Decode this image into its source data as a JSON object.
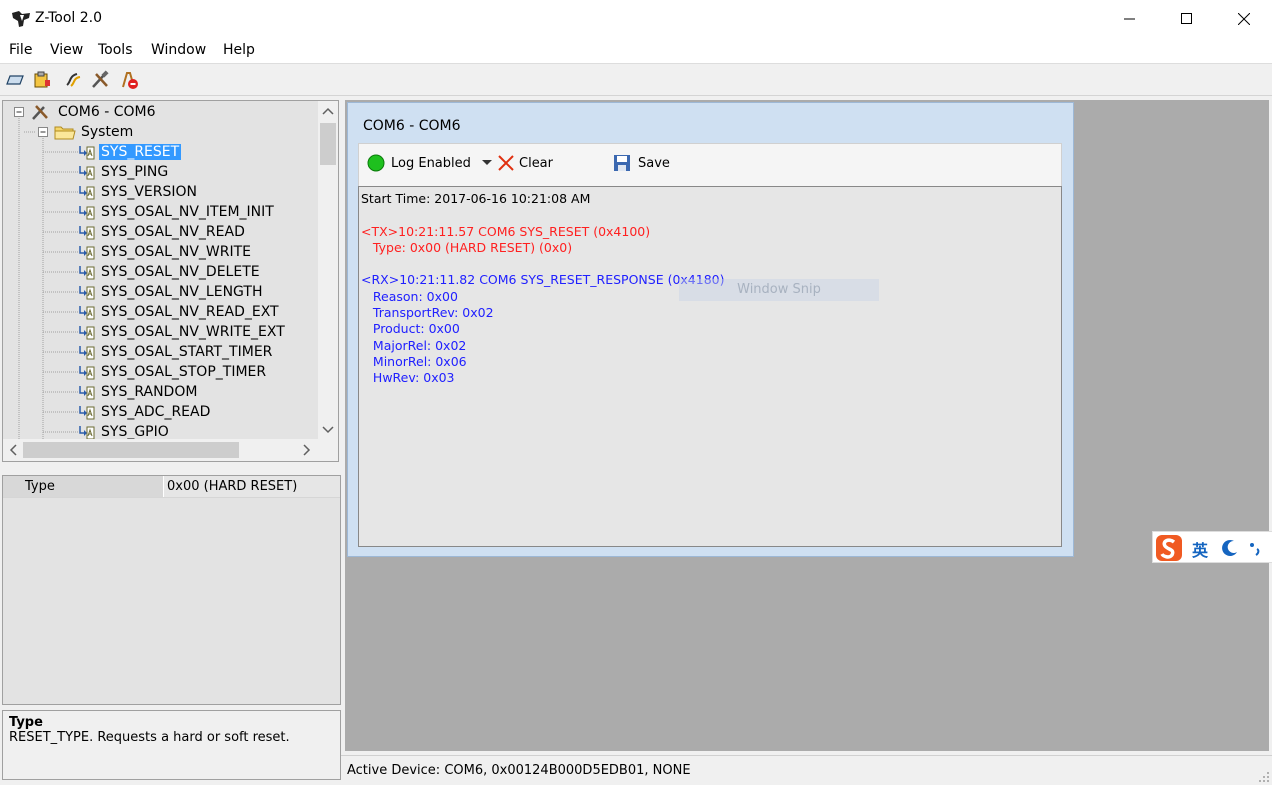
{
  "window": {
    "title": "Z-Tool 2.0"
  },
  "menu": [
    "File",
    "View",
    "Tools",
    "Window",
    "Help"
  ],
  "toolbar_icons": [
    "open-icon",
    "device-icon",
    "script-icon",
    "tools-icon",
    "stop-icon"
  ],
  "tree": {
    "root": "COM6 - COM6",
    "group": "System",
    "selected": "SYS_RESET",
    "items": [
      "SYS_RESET",
      "SYS_PING",
      "SYS_VERSION",
      "SYS_OSAL_NV_ITEM_INIT",
      "SYS_OSAL_NV_READ",
      "SYS_OSAL_NV_WRITE",
      "SYS_OSAL_NV_DELETE",
      "SYS_OSAL_NV_LENGTH",
      "SYS_OSAL_NV_READ_EXT",
      "SYS_OSAL_NV_WRITE_EXT",
      "SYS_OSAL_START_TIMER",
      "SYS_OSAL_STOP_TIMER",
      "SYS_RANDOM",
      "SYS_ADC_READ",
      "SYS_GPIO"
    ]
  },
  "properties": {
    "name": "Type",
    "value": "0x00 (HARD RESET)"
  },
  "help": {
    "title": "Type",
    "text": "RESET_TYPE.  Requests a hard or soft reset."
  },
  "child": {
    "title": "COM6 - COM6",
    "log_enabled_label": "Log Enabled",
    "clear_label": "Clear",
    "save_label": "Save",
    "snip_text": "Window Snip"
  },
  "log": {
    "start": "Start Time: 2017-06-16 10:21:08 AM",
    "tx_line": "<TX>10:21:11.57 COM6 SYS_RESET (0x4100)",
    "tx_type": "   Type: 0x00 (HARD RESET) (0x0)",
    "rx_line": "<RX>10:21:11.82 COM6 SYS_RESET_RESPONSE (0x4180)",
    "rx_fields": [
      "   Reason: 0x00",
      "   TransportRev: 0x02",
      "   Product: 0x00",
      "   MajorRel: 0x02",
      "   MinorRel: 0x06",
      "   HwRev: 0x03"
    ],
    "tx_color": "#ff2020",
    "rx_color": "#2020ff"
  },
  "status": {
    "text": "Active Device: COM6, 0x00124B000D5EDB01, NONE"
  },
  "ime": {
    "label": "英"
  }
}
